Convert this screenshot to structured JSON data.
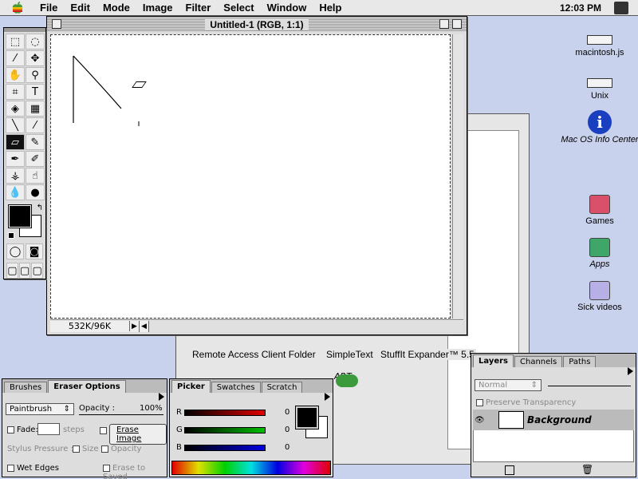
{
  "menubar": {
    "items": [
      "File",
      "Edit",
      "Mode",
      "Image",
      "Filter",
      "Select",
      "Window",
      "Help"
    ],
    "clock": "12:03 PM"
  },
  "document": {
    "title": "Untitled-1 (RGB, 1:1)",
    "status_size": "532K/96K"
  },
  "desktop": {
    "icons": [
      {
        "label": "macintosh.js",
        "kind": "disk"
      },
      {
        "label": "Unix",
        "kind": "disk"
      },
      {
        "label": "Mac OS Info Center",
        "kind": "info"
      },
      {
        "label": "Games",
        "kind": "folder",
        "color": "#d9506a"
      },
      {
        "label": "Apps",
        "kind": "folder",
        "color": "#3fa66a"
      },
      {
        "label": "Sick videos",
        "kind": "folder",
        "color": "#b6b0e6"
      }
    ]
  },
  "finder_window": {
    "items": [
      "Remote Access Client Folder",
      "SimpleText",
      "StuffIt Expander™ 5.5",
      "ART"
    ]
  },
  "brushes_palette": {
    "tabs": [
      "Brushes",
      "Eraser Options"
    ],
    "active_tab": "Eraser Options",
    "mode": "Paintbrush",
    "opacity_label": "Opacity :",
    "opacity_value": "100%",
    "fade_label": "Fade:",
    "steps_label": "steps",
    "erase_image_label": "Erase Image",
    "stylus_label": "Stylus Pressure :",
    "size_label": "Size",
    "opacity_option": "Opacity",
    "wet_edges_label": "Wet Edges",
    "erase_saved_label": "Erase to Saved"
  },
  "picker_palette": {
    "tabs": [
      "Picker",
      "Swatches",
      "Scratch"
    ],
    "active_tab": "Picker",
    "channels": [
      {
        "name": "R",
        "value": "0",
        "color": "#e00000"
      },
      {
        "name": "G",
        "value": "0",
        "color": "#00c000"
      },
      {
        "name": "B",
        "value": "0",
        "color": "#0000e0"
      }
    ]
  },
  "layers_palette": {
    "tabs": [
      "Layers",
      "Channels",
      "Paths"
    ],
    "active_tab": "Layers",
    "blend_mode": "Normal",
    "preserve_label": "Preserve Transparency",
    "layer_name": "Background"
  }
}
